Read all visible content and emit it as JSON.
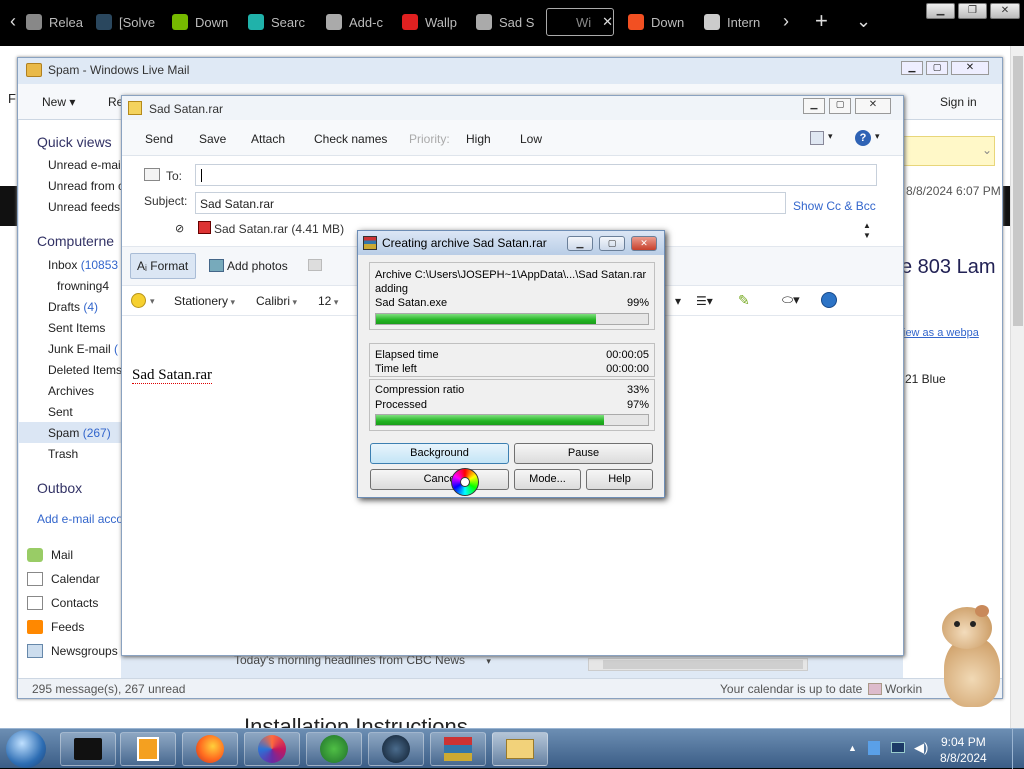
{
  "browser": {
    "tabs": [
      {
        "label": "Relea",
        "icon": "release-icon",
        "color": "#888"
      },
      {
        "label": "[Solve",
        "icon": "steam-icon",
        "color": "#2a475e"
      },
      {
        "label": "Down",
        "icon": "nvidia-icon",
        "color": "#76b900"
      },
      {
        "label": "Searc",
        "icon": "puzzle-icon",
        "color": "#20b2aa"
      },
      {
        "label": "Add-c",
        "icon": "puzzle-outline-icon",
        "color": "#aaa"
      },
      {
        "label": "Wallp",
        "icon": "wallpaper-icon",
        "color": "#e02020"
      },
      {
        "label": "Sad S",
        "icon": "sad-satan-icon",
        "color": "#aaa"
      },
      {
        "label": "Wi",
        "icon": "blank-tab-icon",
        "color": "#000"
      },
      {
        "label": "Down",
        "icon": "microsoft-icon",
        "color": "#f25022"
      },
      {
        "label": "Intern",
        "icon": "archive-icon",
        "color": "#ccc"
      }
    ]
  },
  "background_page": {
    "text_right_1": "8/8/2024 6:07 PM",
    "text_right_2": "e 803 Lam",
    "link_right": "iew as a webpa",
    "text_right_3": "21 Blue",
    "heading_bottom": "Installation Instructions",
    "news_line": "Today's morning headlines from CBC News"
  },
  "wlm": {
    "title": "Spam - Windows Live Mail",
    "toolbar": {
      "new": "New",
      "reply": "Re",
      "sign_in": "Sign in"
    },
    "sidebar": {
      "quick_views": "Quick views",
      "qv_items": [
        "Unread e-mai",
        "Unread from c",
        "Unread feeds"
      ],
      "account": "Computerne",
      "inbox": {
        "label": "Inbox",
        "count": "(10853"
      },
      "sub": "frowning4",
      "drafts": {
        "label": "Drafts",
        "count": "(4)"
      },
      "sent_items": "Sent Items",
      "junk": {
        "label": "Junk E-mail",
        "count": "("
      },
      "deleted": "Deleted Items",
      "archives": "Archives",
      "sent": "Sent",
      "spam": {
        "label": "Spam",
        "count": "(267)"
      },
      "trash": "Trash",
      "outbox": "Outbox",
      "add_account": "Add e-mail acco"
    },
    "nav": [
      "Mail",
      "Calendar",
      "Contacts",
      "Feeds",
      "Newsgroups"
    ],
    "status_left": "295 message(s), 267 unread",
    "status_right": "Your calendar is up to date",
    "status_working": "Workin"
  },
  "compose": {
    "title": "Sad Satan.rar",
    "commands": {
      "send": "Send",
      "save": "Save",
      "attach": "Attach",
      "check_names": "Check names",
      "priority": "Priority:",
      "high": "High",
      "low": "Low"
    },
    "to_label": "To:",
    "to_value": "",
    "subject_label": "Subject:",
    "subject_value": "Sad Satan.rar",
    "show_cc": "Show Cc & Bcc",
    "attachment": "Sad Satan.rar (4.41 MB)",
    "format": "Format",
    "add_photos": "Add photos",
    "stationery": "Stationery",
    "font": "Calibri",
    "size": "12",
    "body": "Sad Satan.rar"
  },
  "rar": {
    "title": "Creating archive Sad Satan.rar",
    "archive": "Archive C:\\Users\\JOSEPH~1\\AppData\\...\\Sad Satan.rar",
    "action": "adding",
    "file": "Sad Satan.exe",
    "file_pct": "99%",
    "file_progress": 0.81,
    "elapsed_label": "Elapsed time",
    "elapsed": "00:00:05",
    "left_label": "Time left",
    "left": "00:00:00",
    "ratio_label": "Compression ratio",
    "ratio": "33%",
    "processed_label": "Processed",
    "processed": "97%",
    "processed_progress": 0.84,
    "buttons": {
      "background": "Background",
      "pause": "Pause",
      "cancel": "Cance",
      "mode": "Mode...",
      "help": "Help"
    }
  },
  "taskbar": {
    "time": "9:04 PM",
    "date": "8/8/2024"
  }
}
